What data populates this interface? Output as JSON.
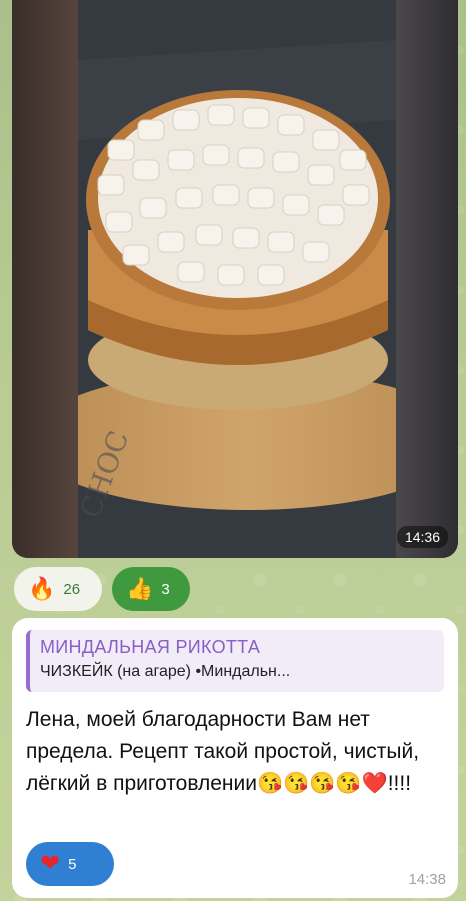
{
  "photo_message": {
    "time": "14:36"
  },
  "reactions_top": [
    {
      "icon": "fire-icon",
      "emoji": "🔥",
      "count": "26"
    },
    {
      "icon": "thumbs-up-icon",
      "emoji": "👍",
      "count": "3"
    }
  ],
  "text_message": {
    "reply": {
      "title": "МИНДАЛЬНАЯ РИКОТТА",
      "text": "ЧИЗКЕЙК (на агаре) •Миндальн..."
    },
    "body": "Лена, моей благодарности Вам нет предела. Рецепт такой простой, чистый, лёгкий в приготовлении😘😘😘😘❤️!!!!",
    "reaction": {
      "icon": "heart-icon",
      "emoji": "❤",
      "count": "5"
    },
    "time": "14:38"
  },
  "colors": {
    "chat_background": "#b4c893",
    "reply_accent": "#9b6ccf",
    "thumb_reaction": "#3f9a3f",
    "heart_reaction": "#2f7fd3"
  }
}
